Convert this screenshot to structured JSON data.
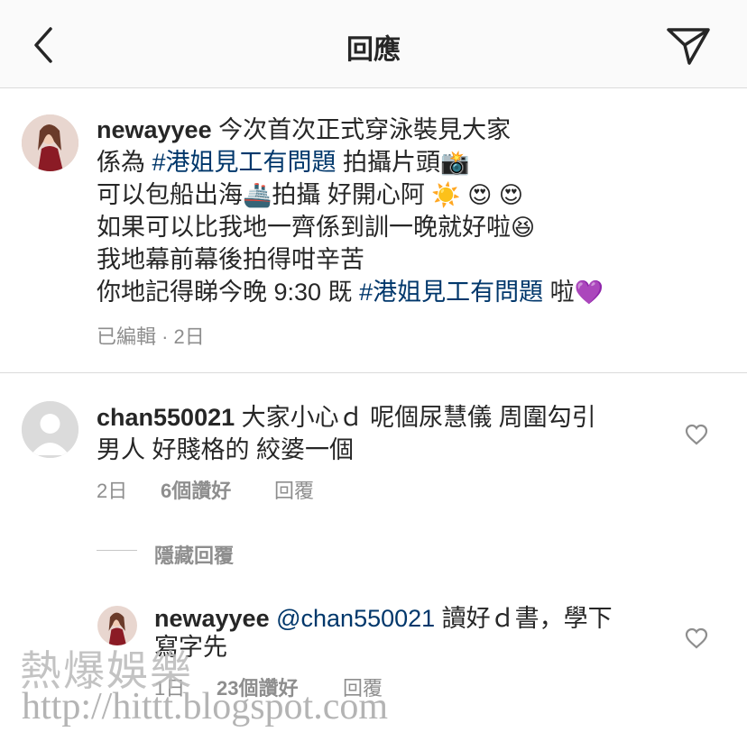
{
  "header": {
    "title": "回應",
    "back_icon": "chevron-left-icon",
    "share_icon": "paper-plane-icon"
  },
  "caption": {
    "username": "newayyee",
    "line1": "今次首次正式穿泳裝見大家",
    "line2_pre": "係為 ",
    "line2_tag": "#港姐見工有問題",
    "line2_post": " 拍攝片頭",
    "line2_emoji": "📸",
    "line3_pre": "可以包船出海",
    "line3_emoji1": "🚢",
    "line3_post": "拍攝 好開心阿 ",
    "line3_emoji2": "☀️",
    "line3_emoji3": "😍",
    "line3_emoji4": "😍",
    "line4": "如果可以比我地一齊係到訓一晚就好啦",
    "line4_emoji": "😆",
    "line5": "我地幕前幕後拍得咁辛苦",
    "line6_pre": "你地記得睇今晚 9:30 既 ",
    "line6_tag": "#港姐見工有問題",
    "line6_post": " 啦",
    "line6_emoji": "💜",
    "meta": "已編輯 · 2日"
  },
  "comment": {
    "username": "chan550021",
    "text1": " 大家小心ｄ 呢個尿慧儀 周圍勾引",
    "text2": "男人 好賤格的 絞婆一個",
    "time": "2日",
    "likes": "6個讚好",
    "reply": "回覆",
    "hide_replies": "隱藏回覆"
  },
  "reply": {
    "username": "newayyee",
    "mention": "@chan550021",
    "text1": " 讀好ｄ書，學下",
    "text2": "寫字先",
    "time": "1日",
    "likes": "23個讚好",
    "reply": "回覆"
  },
  "watermark": {
    "line1": "熱爆娛樂",
    "line2": "http://hittt.blogspot.com"
  },
  "colors": {
    "hashtag": "#00376b",
    "meta": "#8e8e8e",
    "divider": "#dbdbdb"
  }
}
